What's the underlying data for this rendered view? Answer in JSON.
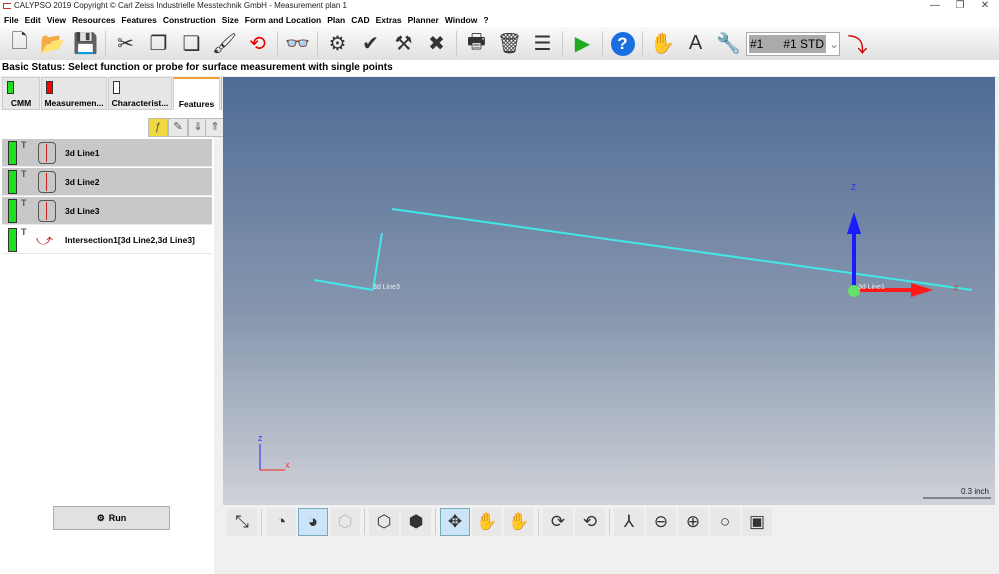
{
  "window": {
    "title": "CALYPSO 2019 Copyright © Carl Zeiss Industrielle Messtechnik GmbH - Measurement plan 1",
    "controls": [
      "—",
      "❐",
      "✕"
    ]
  },
  "menu": [
    "File",
    "Edit",
    "View",
    "Resources",
    "Features",
    "Construction",
    "Size",
    "Form and Location",
    "Plan",
    "CAD",
    "Extras",
    "Planner",
    "Window",
    "?"
  ],
  "toolbar": {
    "icons": [
      "new-icon",
      "open-icon",
      "save-icon",
      "cut-icon",
      "copy-icon",
      "paste-icon",
      "brush-icon",
      "record-icon",
      "binoculars-icon",
      "probe-settings-icon",
      "probe-check-icon",
      "tools-icon",
      "cross-tools-icon",
      "print-icon",
      "delete-icon",
      "report-icon",
      "run-plan-icon",
      "help-icon",
      "probe-hand-icon",
      "probe-text-icon",
      "probe-wrench-icon"
    ],
    "probe_value": "#1      #1 STD",
    "probe_end_icon": "probe-rotate-icon"
  },
  "status": "Basic Status: Select function or probe for surface measurement with single points",
  "tabs": [
    {
      "label": "CMM",
      "indicator": "#1ee01e"
    },
    {
      "label": "Measuremen...",
      "indicator": "#ff0000"
    },
    {
      "label": "Characterist...",
      "indicator": "#ffffff"
    },
    {
      "label": "Features",
      "active": true
    }
  ],
  "features": [
    {
      "label": "3d Line1",
      "selected": true
    },
    {
      "label": "3d Line2",
      "selected": true
    },
    {
      "label": "3d Line3",
      "selected": true
    },
    {
      "label": "Intersection1[3d Line2,3d Line3]",
      "selected": false
    }
  ],
  "flag": "T",
  "run_label": "Run",
  "viewport": {
    "labels": {
      "line3": "3d Line3",
      "line1": "3d Line1",
      "z": "Z",
      "x": "X",
      "mini_z": "Z",
      "mini_x": "X"
    },
    "scale": "0.3 inch",
    "line_color": "#40e8e8"
  },
  "bottom_icons": [
    "select-mode-icon",
    "show-features-icon",
    "show-all-icon",
    "cube-gray-icon",
    "wireframe-icon",
    "solid-cube-icon",
    "move-icon",
    "pan-hand-icon",
    "xyz-hand-icon",
    "rotate-z-icon",
    "rotate-y-icon",
    "axes-icon",
    "zoom-out-icon",
    "zoom-in-icon",
    "zoom-icon",
    "fit-view-icon"
  ]
}
